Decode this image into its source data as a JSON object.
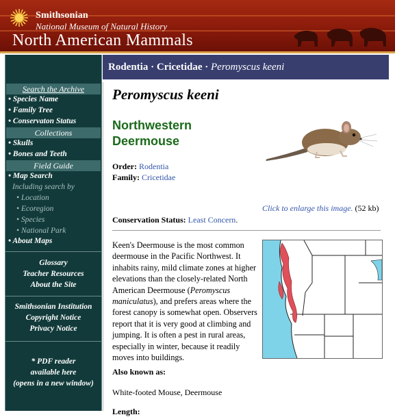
{
  "header": {
    "institution": "Smithsonian",
    "museum": "National Museum of Natural History",
    "site_title": "North American Mammals"
  },
  "sidebar": {
    "search_archive": "Search the Archive",
    "search_items": [
      "• Species Name",
      "• Family Tree",
      "• Conservaton Status"
    ],
    "collections_head": "Collections",
    "collection_items": [
      "• Skulls",
      "• Bones and Teeth"
    ],
    "field_guide_head": "Field Guide",
    "map_search": "• Map Search",
    "including": "Including search by",
    "map_sub_items": [
      "• Location",
      "• Ecoregion",
      "• Species",
      "• National Park"
    ],
    "about_maps": "• About Maps",
    "info_links": [
      "Glossary",
      "Teacher Resources",
      "About the Site"
    ],
    "si_links": [
      "Smithsonian Institution",
      "Copyright Notice",
      "Privacy Notice"
    ],
    "pdf_note": [
      "* PDF reader",
      "available here",
      "(opens in a new window)"
    ]
  },
  "breadcrumb": {
    "order": "Rodentia",
    "sep1": " · ",
    "family": "Cricetidae",
    "sep2": " · ",
    "species": "Peromyscus keeni"
  },
  "species": {
    "scientific_name": "Peromyscus keeni",
    "common_name": "Northwestern Deermouse",
    "order_label": "Order:",
    "order_value": "Rodentia",
    "family_label": "Family:",
    "family_value": "Cricetidae",
    "enlarge_link": "Click to enlarge this image.",
    "enlarge_size": " (52 kb)",
    "conservation_label": "Conservation Status:",
    "conservation_value": "Least Concern",
    "conservation_end": ".",
    "description_1": "Keen's Deermouse is the most common deermouse in the Pacific Northwest. It inhabits rainy, mild climate zones at higher elevations than the closely-related North American Deermouse (",
    "description_italic": "Peromyscus maniculatus",
    "description_2": "), and prefers areas where the forest canopy is somewhat open. Observers report that it is very good at climbing and jumping. It is often a pest in rural areas, especially in winter, because it readily moves into buildings.",
    "also_known_label": "Also known as:",
    "also_known_value": "White-footed Mouse, Deermouse",
    "length_label": "Length:"
  },
  "colors": {
    "header_red": "#8f1d0c",
    "sidebar_teal": "#123a3a",
    "taxbar_blue": "#383e6e",
    "common_name_green": "#1a6a1a",
    "link_blue": "#3355aa",
    "range_red": "#e0505a"
  }
}
